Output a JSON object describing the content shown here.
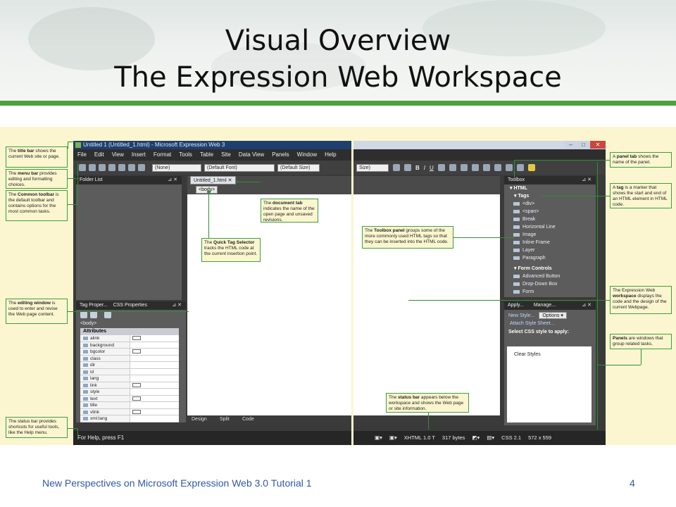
{
  "slide": {
    "title_line1": "Visual Overview",
    "title_line2": "The Expression Web Workspace",
    "footer": "New Perspectives on Microsoft Expression Web 3.0 Tutorial 1",
    "page_number": "4",
    "accent_green": "#4aa33c"
  },
  "app": {
    "window_title": "Untitled 1 (Untitled_1.html) - Microsoft Expression Web 3",
    "menu": [
      "File",
      "Edit",
      "View",
      "Insert",
      "Format",
      "Tools",
      "Table",
      "Site",
      "Data View",
      "Panels",
      "Window",
      "Help"
    ],
    "style_dropdown": "(None)",
    "font_dropdown": "(Default Font)",
    "size_dropdown_left": "(Default Size)",
    "size_dropdown_right": "Size)",
    "format_buttons": [
      "B",
      "I",
      "U"
    ],
    "folder_list_title": "Folder List",
    "doc_tab": "Untitled_1.html",
    "quick_tag": "<body>",
    "view_tabs": [
      "Design",
      "Split",
      "Code"
    ],
    "status_left": "For Help, press F1",
    "status_right": [
      "XHTML 1.0 T",
      "317 bytes",
      "CSS 2.1",
      "572 x 559"
    ],
    "tag_panel": {
      "tabs": [
        "Tag Proper...",
        "CSS Properties"
      ],
      "tag_label": "<body>",
      "section": "Attributes",
      "rows": [
        {
          "name": "alink",
          "box": true
        },
        {
          "name": "background",
          "box": false
        },
        {
          "name": "bgcolor",
          "box": true
        },
        {
          "name": "class",
          "box": false
        },
        {
          "name": "dir",
          "box": false
        },
        {
          "name": "id",
          "box": false
        },
        {
          "name": "lang",
          "box": false
        },
        {
          "name": "link",
          "box": true
        },
        {
          "name": "style",
          "box": false
        },
        {
          "name": "text",
          "box": true
        },
        {
          "name": "title",
          "box": false
        },
        {
          "name": "vlink",
          "box": true
        },
        {
          "name": "xml:lang",
          "box": false
        }
      ]
    },
    "toolbox": {
      "title": "Toolbox",
      "group": "HTML",
      "tags_heading": "Tags",
      "tags": [
        "<div>",
        "<span>",
        "Break",
        "Horizontal Line",
        "Image",
        "Inline Frame",
        "Layer",
        "Paragraph"
      ],
      "form_heading": "Form Controls",
      "form_items": [
        "Advanced Button",
        "Drop-Down Box",
        "Form"
      ]
    },
    "apply_panel": {
      "tabs": [
        "Apply...",
        "Manage..."
      ],
      "new_style": "New Style...",
      "options": "Options",
      "attach": "Attach Style Sheet...",
      "select_label": "Select CSS style to apply:",
      "clear_styles": "Clear Styles"
    }
  },
  "callouts": {
    "title_bar": {
      "bold": "title bar",
      "pre": "The ",
      "post": " shows the current Web site or page."
    },
    "menu_bar": {
      "bold": "menu bar",
      "pre": "The ",
      "post": " provides editing and formatting choices."
    },
    "common_toolbar": {
      "bold": "Common toolbar",
      "pre": "The ",
      "post": " is the default toolbar and contains options for the most common tasks."
    },
    "editing_window": {
      "bold": "editing window",
      "pre": "The ",
      "post": " is used to enter and revise the Web page content."
    },
    "status_bar_left": {
      "bold": "",
      "pre": "The status bar provides shortcuts for useful tools, like the Help menu.",
      "post": ""
    },
    "document_tab": {
      "bold": "document tab",
      "pre": "The ",
      "post": " indicates the name of the open page and unsaved revisions."
    },
    "quick_tag": {
      "bold": "Quick Tag Selector",
      "pre": "The ",
      "post": " tracks the HTML code at the current insertion point."
    },
    "toolbox": {
      "bold": "Toolbox panel",
      "pre": "The ",
      "post": " groups some of the more commonly used HTML tags so that they can be inserted into the HTML code."
    },
    "status_bar_bottom": {
      "bold": "status bar",
      "pre": "The ",
      "post": " appears below the workspace and shows the Web page or site information."
    },
    "panel_tab": {
      "bold": "panel tab",
      "pre": "A ",
      "post": " shows the name of the panel."
    },
    "tag": {
      "bold": "tag",
      "pre": "A ",
      "post": " is a marker that shows the start and end of an HTML element in HTML code."
    },
    "workspace": {
      "bold": "workspace",
      "pre": "The Expression Web ",
      "post": " displays the code and the design of the current Webpage."
    },
    "panels": {
      "bold": "Panels",
      "pre": "",
      "post": " are windows that group related tasks."
    }
  }
}
